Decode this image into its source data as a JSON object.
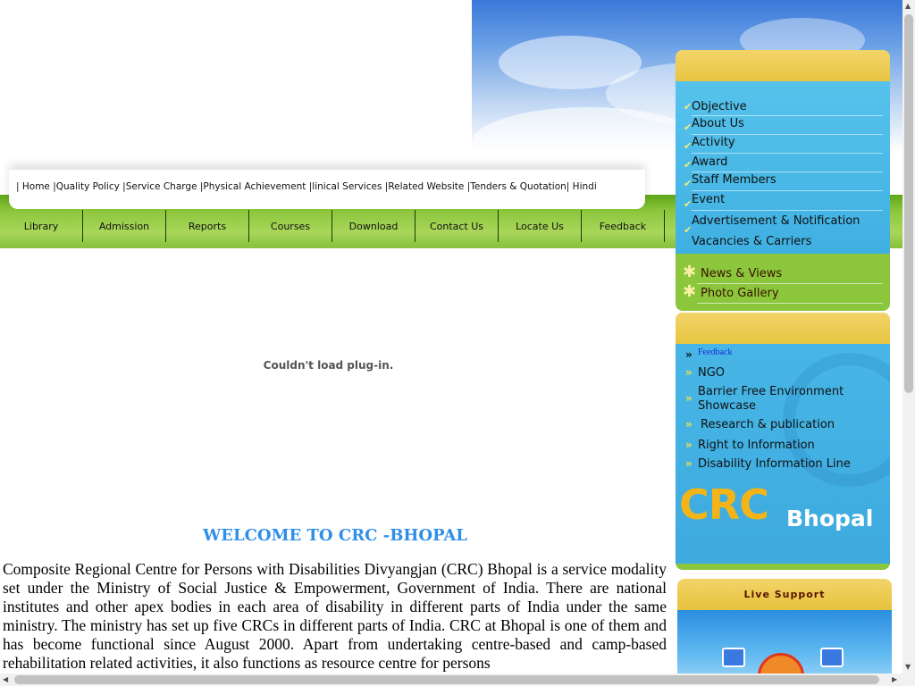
{
  "top_links": [
    "| Home",
    " |Quality Policy",
    " |Service Charge",
    " |Physical Achievement",
    " |linical Services",
    " |Related Website",
    " |Tenders & Quotation|",
    " Hindi"
  ],
  "nav": [
    "Library",
    "Admission",
    "Reports",
    "Courses",
    "Download",
    "Contact Us",
    "Locate Us",
    "Feedback"
  ],
  "main": {
    "plugin_message": "Couldn't load plug-in.",
    "welcome_title": "WELCOME TO CRC -BHOPAL",
    "intro_text": "Composite Regional Centre for Persons with Disabilities Divyangjan (CRC) Bhopal is a service modality set under the Ministry of Social Justice & Empowerment, Government of India. There are national institutes and other apex bodies in each area of disability in different parts of India under the same ministry. The ministry has set up five CRCs in different parts of India. CRC at Bhopal is one of them and has become functional since August 2000. Apart from undertaking centre-based and camp-based rehabilitation related activities, it also functions as resource centre for persons"
  },
  "sidebar": {
    "menu_items": [
      "Objective",
      "About Us",
      "Activity",
      "Award",
      "Staff Members",
      "Event",
      "Advertisement & Notification",
      "Vacancies & Carriers"
    ],
    "green_items": [
      "News & Views",
      "Photo Gallery"
    ],
    "feedback_link": "Feedback",
    "links": [
      "NGO",
      "Barrier Free Environment Showcase",
      "Research & publication",
      "Right to Information",
      "Disability Information Line"
    ],
    "logo_crc": "CRC",
    "logo_city": "Bhopal",
    "live_support_title": "Live Support"
  },
  "icons": {
    "check": "checkmark-icon",
    "star": "star-bullet-icon",
    "double_chevron": "double-chevron-icon"
  },
  "colors": {
    "accent_green": "#8cc63c",
    "panel_blue": "#3fb0e2",
    "panel_gold": "#e8c541",
    "welcome_blue": "#2f8fe8",
    "logo_gold": "#f4b417"
  }
}
